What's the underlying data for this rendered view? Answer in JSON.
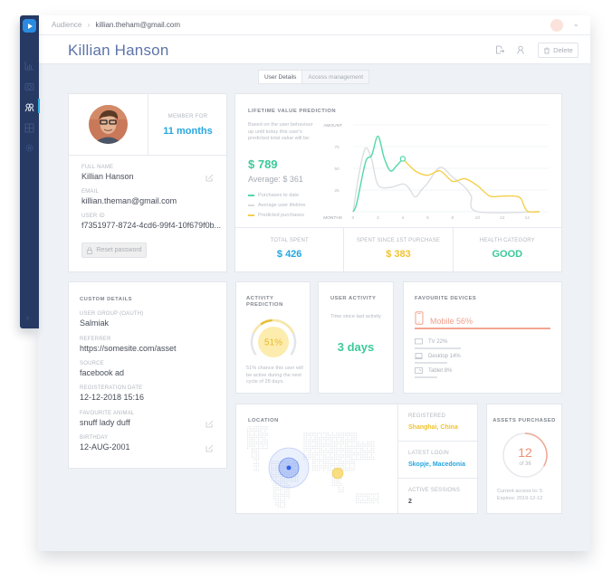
{
  "app": {
    "brand_color": "#263a64",
    "accent": "#27a6df"
  },
  "sidebar": {
    "items": [
      {
        "name": "analytics",
        "icon": "bar-chart-icon",
        "active": false
      },
      {
        "name": "media",
        "icon": "camera-icon",
        "active": false
      },
      {
        "name": "audience",
        "icon": "users-icon",
        "active": true
      },
      {
        "name": "reports",
        "icon": "grid-icon",
        "active": false
      },
      {
        "name": "settings",
        "icon": "gear-icon",
        "active": false
      }
    ],
    "expand_icon": "chevron-right-icon"
  },
  "topbar": {
    "breadcrumb": [
      "Audience",
      "killian.theham@gmail.com"
    ],
    "breadcrumb_sep": "›",
    "menu_chevron": "⌄"
  },
  "header": {
    "title": "Killian Hanson",
    "delete_label": "Delete"
  },
  "tabs": [
    {
      "label": "User Details",
      "active": true
    },
    {
      "label": "Access management",
      "active": false
    }
  ],
  "profile": {
    "member_for_label": "MEMBER FOR",
    "member_for_value": "11 months",
    "fields": [
      {
        "label": "FULL NAME",
        "value": "Killian Hanson",
        "editable": true
      },
      {
        "label": "EMAIL",
        "value": "killian.theman@gmail.com",
        "editable": false
      },
      {
        "label": "USER ID",
        "value": "f7351977-8724-4cd6-99f4-10f679f0b...",
        "editable": false
      }
    ],
    "reset_password_label": "Reset password"
  },
  "ltv": {
    "title": "LIFETIME VALUE PREDICTION",
    "description": "Based on the user behaviour up until today this user's predicted total value will be:",
    "predicted_value": "$ 789",
    "average": "Average: $ 361",
    "legend": [
      {
        "label": "Purchases to date",
        "color": "#4fd9a6"
      },
      {
        "label": "Average user lifetime",
        "color": "#d9dbdf"
      },
      {
        "label": "Predicted purchases",
        "color": "#f5cf4a"
      }
    ],
    "stats": [
      {
        "label": "TOTAL SPENT",
        "value": "$ 426",
        "color": "#27a6df"
      },
      {
        "label": "SPENT SINCE 1ST PURCHASE",
        "value": "$ 383",
        "color": "#f2c230"
      },
      {
        "label": "HEALTH CATEGORY",
        "value": "GOOD",
        "color": "#3cc99a"
      }
    ]
  },
  "chart_data": {
    "type": "line",
    "title": "LIFETIME VALUE PREDICTION",
    "xlabel": "MONTHS",
    "ylabel": "AMOUNT",
    "xlim": [
      0,
      15
    ],
    "ylim": [
      0,
      100
    ],
    "x_ticks": [
      0,
      2,
      4,
      6,
      8,
      10,
      12,
      14
    ],
    "y_ticks": [
      25,
      50,
      75
    ],
    "grid": true,
    "series": [
      {
        "name": "Purchases to date",
        "color": "#4fd9a6",
        "x": [
          0,
          0.3,
          1,
          1.5,
          2,
          2.5,
          3,
          3.5,
          4
        ],
        "y": [
          0,
          10,
          57,
          65,
          87,
          62,
          47,
          53,
          61
        ]
      },
      {
        "name": "Average user lifetime",
        "color": "#dcdee2",
        "x": [
          0,
          0.5,
          1,
          1.5,
          2,
          3,
          4,
          4.5,
          5,
          5.5,
          6,
          7,
          8,
          9,
          9.5,
          10,
          15
        ],
        "y": [
          0,
          45,
          73,
          60,
          31,
          28,
          32,
          27,
          17,
          25,
          33,
          51,
          40,
          28,
          18,
          0,
          0
        ]
      },
      {
        "name": "Predicted purchases",
        "color": "#f5cf4a",
        "x": [
          4,
          5,
          6,
          7,
          8,
          9,
          10,
          11,
          12,
          13,
          13.5,
          14,
          15
        ],
        "y": [
          61,
          47,
          42,
          47,
          35,
          38,
          30,
          18,
          18,
          18,
          15,
          1,
          0
        ]
      }
    ],
    "markers": [
      {
        "series": "Purchases to date",
        "x": 4,
        "y": 61
      }
    ]
  },
  "activity_prediction": {
    "title": "ACTIVITY PREDICTION",
    "percent": 51,
    "percent_label": "51%",
    "description": "51% chance this user will be active during the next cycle of 28 days."
  },
  "user_activity": {
    "title": "USER ACTIVITY",
    "subtitle": "Time since last activity",
    "value": "3 days"
  },
  "devices": {
    "title": "FAVOURITE DEVICES",
    "primary": {
      "label": "Mobile 56%",
      "percent": 56,
      "icon": "mobile-icon",
      "color": "#f0a08c"
    },
    "others": [
      {
        "label": "TV 22%",
        "percent": 22,
        "icon": "tv-icon"
      },
      {
        "label": "Desktop 14%",
        "percent": 14,
        "icon": "desktop-icon"
      },
      {
        "label": "Tablet 8%",
        "percent": 8,
        "icon": "tablet-icon"
      }
    ]
  },
  "location": {
    "title": "LOCATION",
    "registered_label": "REGISTERED",
    "registered_value": "Shanghai, China",
    "latest_login_label": "LATEST LOGIN",
    "latest_login_value": "Skopje, Macedonia",
    "active_sessions_label": "ACTIVE SESSIONS",
    "active_sessions_value": "2"
  },
  "assets": {
    "title": "ASSETS PURCHASED",
    "count": "12",
    "of_label": "of 36",
    "fraction": 0.3333,
    "current_access": "Current access to: 5",
    "expires": "Expires: 2019-12-12"
  }
}
